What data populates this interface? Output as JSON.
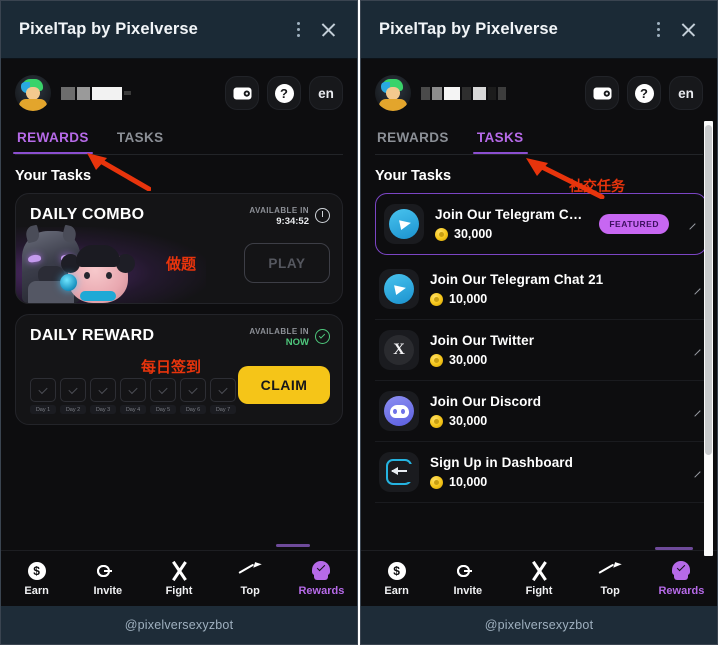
{
  "window": {
    "title": "PixelTap by Pixelverse",
    "menu_icon": "kebab-menu-icon",
    "close_icon": "close-icon"
  },
  "user": {
    "avatar_icon": "user-avatar",
    "name_redacted": true
  },
  "header_actions": {
    "wallet_label": "wallet-icon",
    "help_label": "?",
    "language": "en"
  },
  "tabs": [
    {
      "id": "rewards",
      "label": "REWARDS"
    },
    {
      "id": "tasks",
      "label": "TASKS"
    }
  ],
  "section": {
    "title": "Your Tasks"
  },
  "rewards": {
    "daily_combo": {
      "title": "DAILY COMBO",
      "available_label": "AVAILABLE IN",
      "available_value": "9:34:52",
      "action_label": "PLAY",
      "status_icon": "clock-icon"
    },
    "daily_reward": {
      "title": "DAILY REWARD",
      "available_label": "AVAILABLE IN",
      "available_value": "NOW",
      "action_label": "CLAIM",
      "status_icon": "check-circle-icon",
      "days": [
        {
          "label": "Day 1"
        },
        {
          "label": "Day 2"
        },
        {
          "label": "Day 3"
        },
        {
          "label": "Day 4"
        },
        {
          "label": "Day 5"
        },
        {
          "label": "Day 6"
        },
        {
          "label": "Day 7"
        }
      ]
    }
  },
  "tasks": [
    {
      "name": "Join Our Telegram Ch…",
      "amount": "30,000",
      "icon": "telegram-icon",
      "badge": "FEATURED",
      "featured": true
    },
    {
      "name": "Join Our Telegram Chat 21",
      "amount": "10,000",
      "icon": "telegram-icon",
      "badge": "",
      "featured": false
    },
    {
      "name": "Join Our Twitter",
      "amount": "30,000",
      "icon": "twitter-x-icon",
      "badge": "",
      "featured": false
    },
    {
      "name": "Join Our Discord",
      "amount": "30,000",
      "icon": "discord-icon",
      "badge": "",
      "featured": false
    },
    {
      "name": "Sign Up in Dashboard",
      "amount": "10,000",
      "icon": "dashboard-signup-icon",
      "badge": "",
      "featured": false
    }
  ],
  "bottom_nav": [
    {
      "id": "earn",
      "label": "Earn",
      "icon": "coin-dollar-icon",
      "active": false
    },
    {
      "id": "invite",
      "label": "Invite",
      "icon": "link-icon",
      "active": false
    },
    {
      "id": "fight",
      "label": "Fight",
      "icon": "swords-icon",
      "active": false
    },
    {
      "id": "top",
      "label": "Top",
      "icon": "trending-up-icon",
      "active": false
    },
    {
      "id": "rewards",
      "label": "Rewards",
      "icon": "reward-badge-icon",
      "active": true
    }
  ],
  "footer": {
    "handle": "@pixelversexyzbot"
  },
  "annotations": [
    {
      "id": "left-combo-note",
      "text": "做题",
      "color": "#e8340c"
    },
    {
      "id": "left-reward-note",
      "text": "每日签到",
      "color": "#e8340c"
    },
    {
      "id": "right-tasks-note",
      "text": "社交任务",
      "color": "#e8340c"
    }
  ],
  "colors": {
    "accent_purple": "#b66ae8",
    "claim_yellow": "#f5c518",
    "available_now_green": "#4ec77c",
    "titlebar_blue": "#1b2a36",
    "annotation_red": "#e8340c"
  }
}
